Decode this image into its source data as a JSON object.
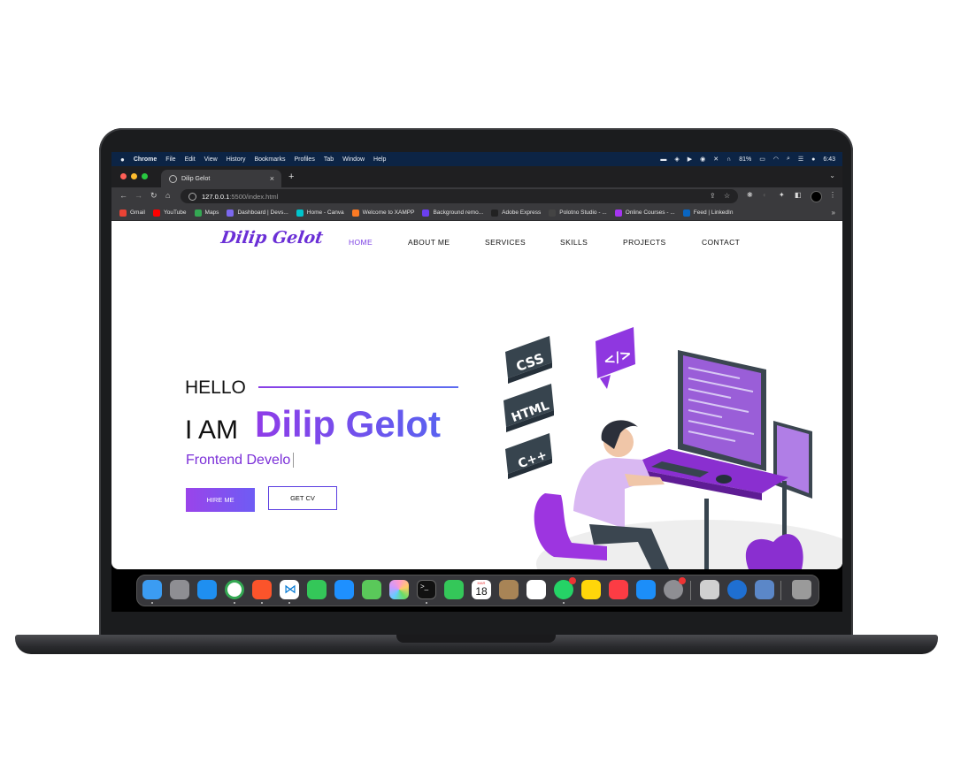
{
  "menubar": {
    "apple": "",
    "items": [
      "Chrome",
      "File",
      "Edit",
      "View",
      "History",
      "Bookmarks",
      "Profiles",
      "Tab",
      "Window",
      "Help"
    ],
    "battery": "81%",
    "time": "6:43"
  },
  "tab": {
    "title": "Dilip Gelot",
    "close": "×",
    "new_tab": "+"
  },
  "address": {
    "host": "127.0.0.1",
    "path": ":5500/index.html"
  },
  "bookmarks": [
    {
      "label": "Gmail",
      "color": "#ea4335"
    },
    {
      "label": "YouTube",
      "color": "#ff0000"
    },
    {
      "label": "Maps",
      "color": "#34a853"
    },
    {
      "label": "Dashboard | Devs...",
      "color": "#7b68ee"
    },
    {
      "label": "Home - Canva",
      "color": "#00c4cc"
    },
    {
      "label": "Welcome to XAMPP",
      "color": "#fb7a24"
    },
    {
      "label": "Background remo...",
      "color": "#6b3ff0"
    },
    {
      "label": "Adobe Express",
      "color": "#222222"
    },
    {
      "label": "Polotno Studio - ...",
      "color": "#444444"
    },
    {
      "label": "Online Courses - ...",
      "color": "#a435f0"
    },
    {
      "label": "Feed | LinkedIn",
      "color": "#0a66c2"
    }
  ],
  "bookmarks_more": "»",
  "site": {
    "logo": "Dilip Gelot",
    "nav": [
      "HOME",
      "ABOUT ME",
      "SERVICES",
      "SKILLS",
      "PROJECTS",
      "CONTACT"
    ],
    "hello": "HELLO",
    "iam": "I AM",
    "name": "Dilip Gelot",
    "role": "Frontend Develo",
    "hire_label": "HIRE ME",
    "cv_label": "GET CV"
  },
  "illustration": {
    "tags": [
      "CSS",
      "HTML",
      "C++"
    ],
    "bubble": "</>"
  },
  "dock": {
    "calendar_month": "MAR",
    "calendar_day": "18"
  },
  "colors": {
    "accent": "#7b3fe4",
    "menubar": "#0c2445",
    "tabbar": "#1f1f21",
    "toolbar": "#3a3a3d"
  }
}
